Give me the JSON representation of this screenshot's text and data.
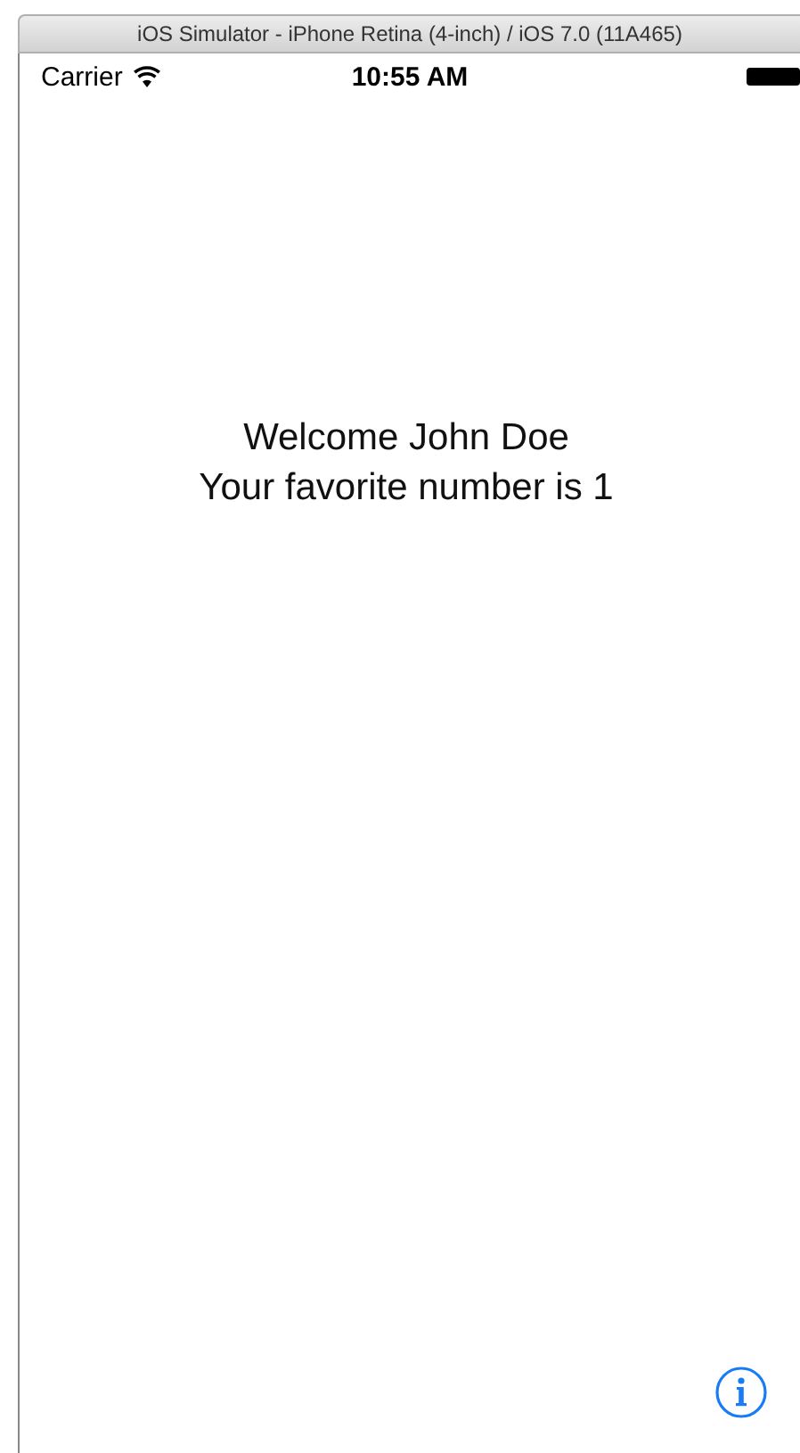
{
  "window": {
    "title": "iOS Simulator - iPhone Retina (4-inch) / iOS 7.0 (11A465)"
  },
  "status_bar": {
    "carrier": "Carrier",
    "time": "10:55 AM"
  },
  "content": {
    "lines": [
      "Welcome John Doe",
      "Your favorite number is 1"
    ]
  }
}
